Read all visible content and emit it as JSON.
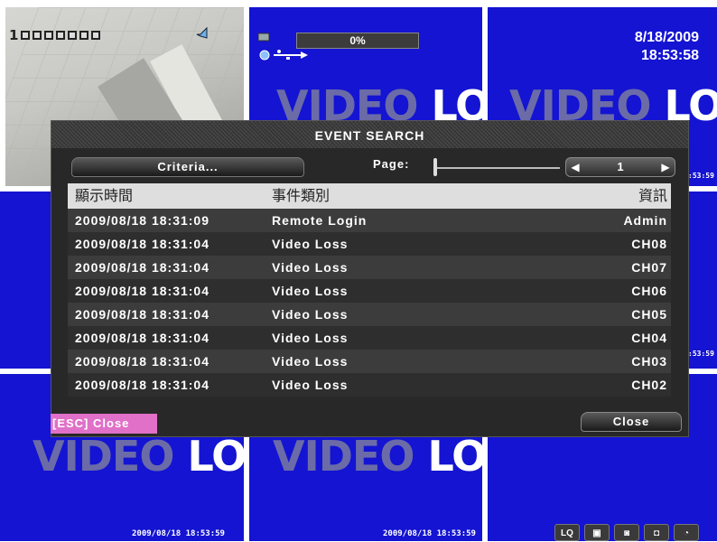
{
  "overlay": {
    "channel_label": "1",
    "storage_progress": "0%",
    "date": "8/18/2009",
    "time": "18:53:58",
    "video_loss_word1": "VIDEO",
    "video_loss_word2": "LOSS",
    "tile_timestamp": "2009/08/18 18:53:59",
    "edge_time_fragment": ":53:59"
  },
  "dialog": {
    "title": "EVENT SEARCH",
    "criteria_label": "Criteria...",
    "page_label": "Page:",
    "page_number": "1",
    "prev_arrow": "◀",
    "next_arrow": "▶",
    "close_label": "Close",
    "esc_hint": "[ESC] Close",
    "columns": [
      "顯示時間",
      "事件類別",
      "資訊"
    ],
    "rows": [
      {
        "time": "2009/08/18 18:31:09",
        "event": "Remote Login",
        "info": "Admin"
      },
      {
        "time": "2009/08/18 18:31:04",
        "event": "Video Loss",
        "info": "CH08"
      },
      {
        "time": "2009/08/18 18:31:04",
        "event": "Video Loss",
        "info": "CH07"
      },
      {
        "time": "2009/08/18 18:31:04",
        "event": "Video Loss",
        "info": "CH06"
      },
      {
        "time": "2009/08/18 18:31:04",
        "event": "Video Loss",
        "info": "CH05"
      },
      {
        "time": "2009/08/18 18:31:04",
        "event": "Video Loss",
        "info": "CH04"
      },
      {
        "time": "2009/08/18 18:31:04",
        "event": "Video Loss",
        "info": "CH03"
      },
      {
        "time": "2009/08/18 18:31:04",
        "event": "Video Loss",
        "info": "CH02"
      }
    ]
  },
  "toolbar": {
    "icons": [
      "LQ",
      "▣",
      "◙",
      "◘",
      "◔"
    ]
  },
  "colors": {
    "tile_blue": "#1414d2",
    "video_word": "#6b6ba8",
    "esc_pink": "#e070c8"
  }
}
